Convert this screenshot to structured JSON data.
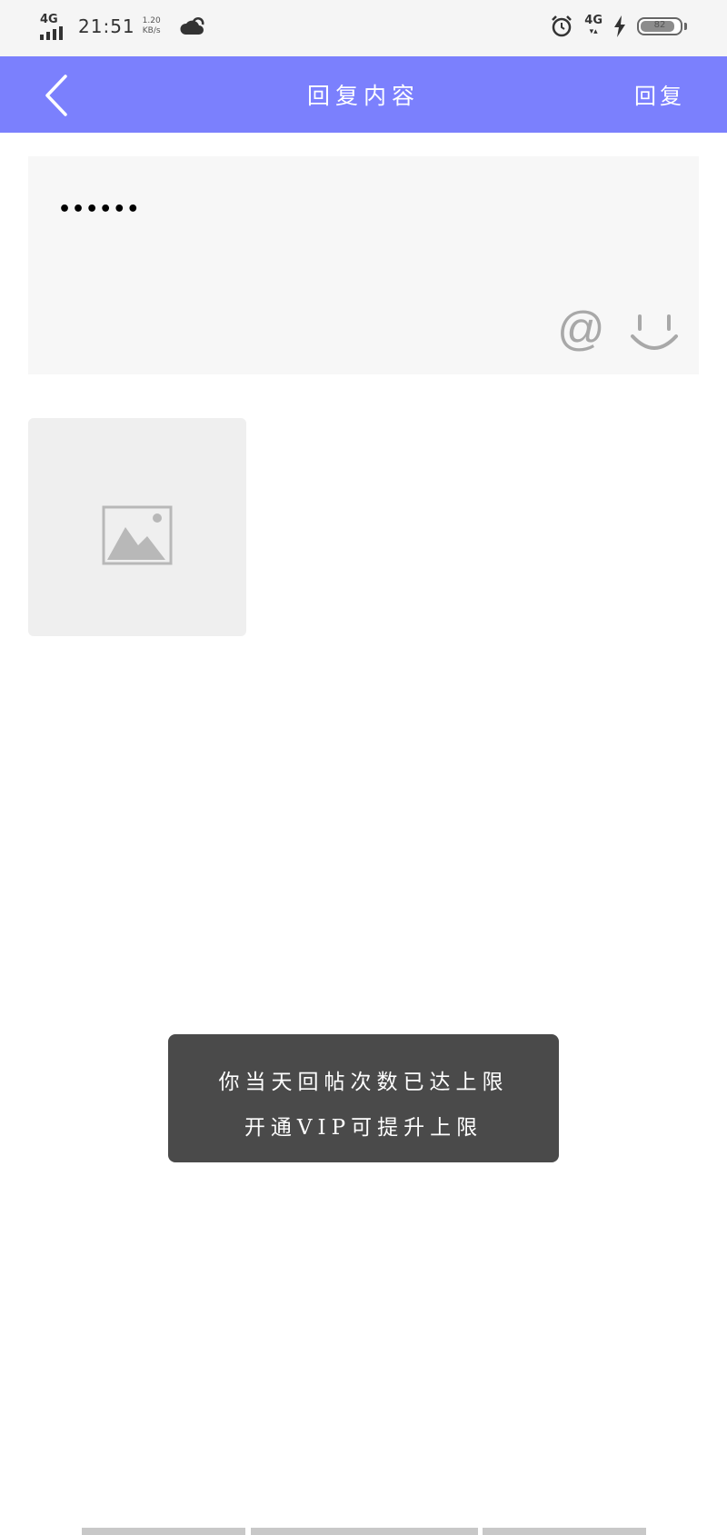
{
  "status_bar": {
    "network_left": "4G",
    "time": "21:51",
    "speed_value": "1.20",
    "speed_unit": "KB/s",
    "network_right": "4G",
    "battery": "82"
  },
  "app_bar": {
    "title": "回复内容",
    "action_label": "回复"
  },
  "editor": {
    "text": "••••••",
    "at_symbol": "@"
  },
  "toast": {
    "line1": "你当天回帖次数已达上限",
    "line2": "开通VIP可提升上限"
  },
  "colors": {
    "header": "#7b80fd",
    "toast_bg": "#4a4a4a",
    "editor_bg": "#f7f7f7",
    "image_slot_bg": "#efefef"
  },
  "icons": [
    "signal-icon",
    "weather-cloud-icon",
    "alarm-icon",
    "charging-icon",
    "battery-icon",
    "back-arrow-icon",
    "at-icon",
    "emoji-smile-icon",
    "image-placeholder-icon"
  ]
}
